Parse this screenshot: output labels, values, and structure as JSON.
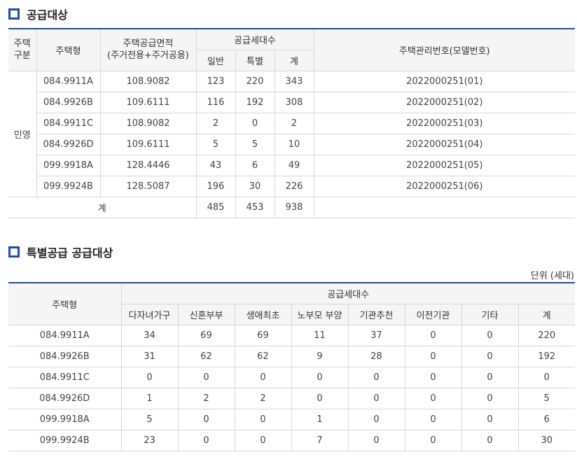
{
  "section1": {
    "title": "공급대상",
    "headers": {
      "gubun": "주택 구분",
      "type": "주택형",
      "area": "주택공급면적 (주거전용+주거공용)",
      "units": "공급세대수",
      "general": "일반",
      "special": "특별",
      "total": "계",
      "mgmt": "주택관리번호(모델번호)"
    },
    "category": "민영",
    "rows": [
      {
        "type": "084.9911A",
        "area": "108.9082",
        "general": "123",
        "special": "220",
        "total": "343",
        "mgmt": "2022000251(01)"
      },
      {
        "type": "084.9926B",
        "area": "109.6111",
        "general": "116",
        "special": "192",
        "total": "308",
        "mgmt": "2022000251(02)"
      },
      {
        "type": "084.9911C",
        "area": "108.9082",
        "general": "2",
        "special": "0",
        "total": "2",
        "mgmt": "2022000251(03)"
      },
      {
        "type": "084.9926D",
        "area": "109.6111",
        "general": "5",
        "special": "5",
        "total": "10",
        "mgmt": "2022000251(04)"
      },
      {
        "type": "099.9918A",
        "area": "128.4446",
        "general": "43",
        "special": "6",
        "total": "49",
        "mgmt": "2022000251(05)"
      },
      {
        "type": "099.9924B",
        "area": "128.5087",
        "general": "196",
        "special": "30",
        "total": "226",
        "mgmt": "2022000251(06)"
      }
    ],
    "sum": {
      "label": "계",
      "general": "485",
      "special": "453",
      "total": "938"
    }
  },
  "section2": {
    "title": "특별공급 공급대상",
    "unit": "단위 (세대)",
    "headers": {
      "type": "주택형",
      "units": "공급세대수",
      "cols": [
        "다자녀가구",
        "신혼부부",
        "생애최초",
        "노부모 부양",
        "기관추천",
        "이전기관",
        "기타",
        "계"
      ]
    },
    "rows": [
      {
        "type": "084.9911A",
        "vals": [
          "34",
          "69",
          "69",
          "11",
          "37",
          "0",
          "0",
          "220"
        ]
      },
      {
        "type": "084.9926B",
        "vals": [
          "31",
          "62",
          "62",
          "9",
          "28",
          "0",
          "0",
          "192"
        ]
      },
      {
        "type": "084.9911C",
        "vals": [
          "0",
          "0",
          "0",
          "0",
          "0",
          "0",
          "0",
          "0"
        ]
      },
      {
        "type": "084.9926D",
        "vals": [
          "1",
          "2",
          "2",
          "0",
          "0",
          "0",
          "0",
          "5"
        ]
      },
      {
        "type": "099.9918A",
        "vals": [
          "5",
          "0",
          "0",
          "1",
          "0",
          "0",
          "0",
          "6"
        ]
      },
      {
        "type": "099.9924B",
        "vals": [
          "23",
          "0",
          "0",
          "7",
          "0",
          "0",
          "0",
          "30"
        ]
      }
    ]
  }
}
